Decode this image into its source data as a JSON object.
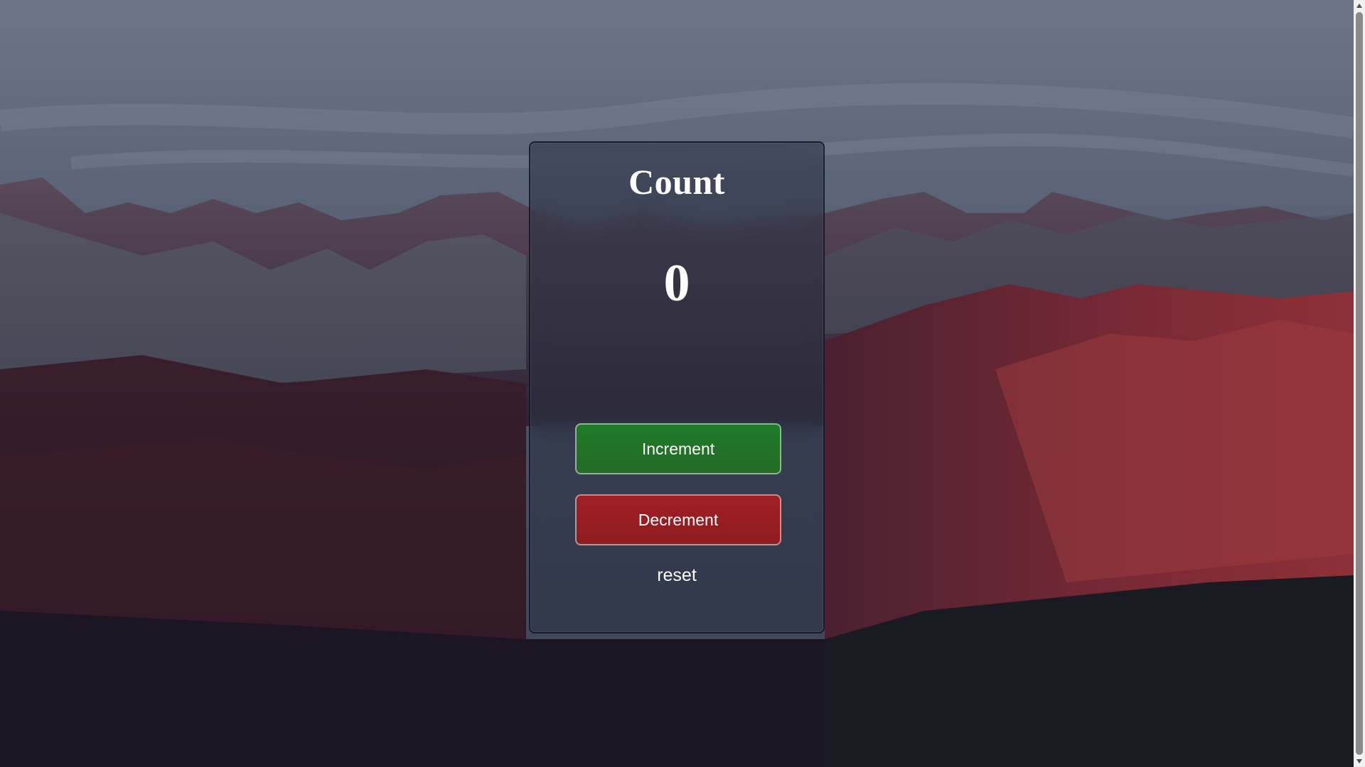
{
  "card": {
    "title": "Count",
    "count": "0"
  },
  "buttons": {
    "increment_label": "Increment",
    "decrement_label": "Decrement",
    "reset_label": "reset"
  },
  "colors": {
    "increment": "#1f7a28",
    "decrement": "#a01f24",
    "text": "#ffffff"
  },
  "icons": {
    "scroll_up": "chevron-up-icon",
    "scroll_down": "chevron-down-icon"
  }
}
